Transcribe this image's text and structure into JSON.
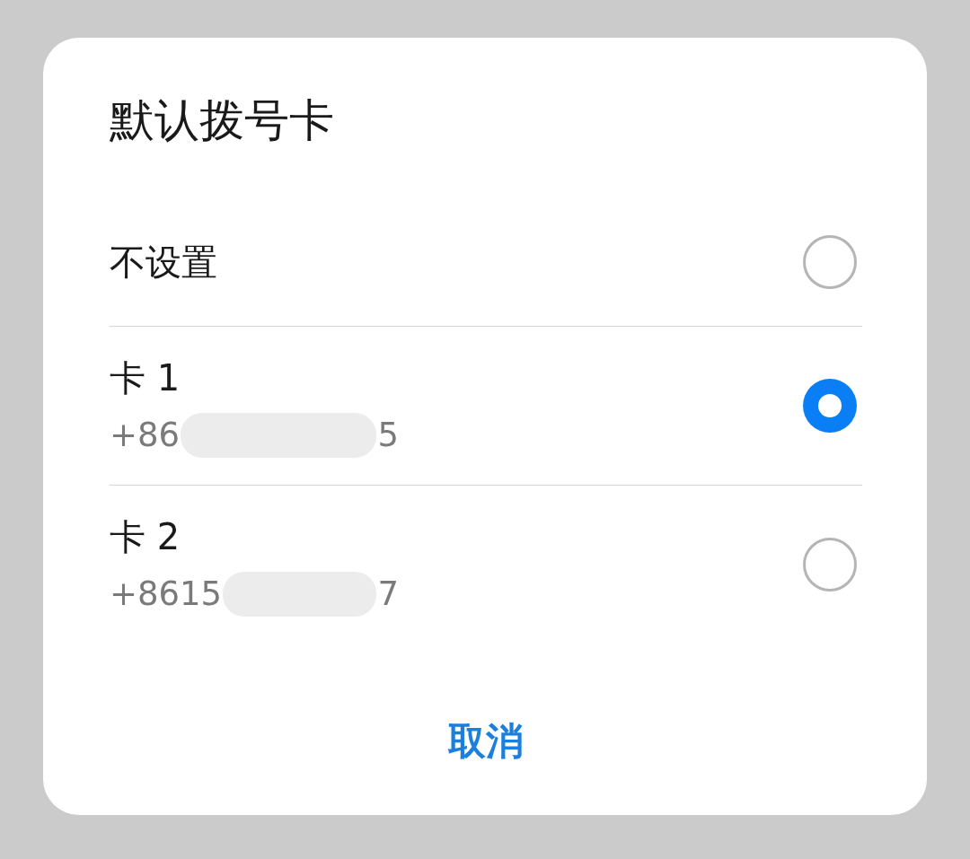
{
  "dialog": {
    "title": "默认拨号卡"
  },
  "options": [
    {
      "label": "不设置",
      "selected": false
    },
    {
      "label": "卡 1",
      "phone": {
        "start": "+86",
        "end": "5"
      },
      "selected": true
    },
    {
      "label": "卡 2",
      "phone": {
        "start": "+8615",
        "end": "7"
      },
      "selected": false
    }
  ],
  "buttons": [
    {
      "label": "取消"
    }
  ]
}
